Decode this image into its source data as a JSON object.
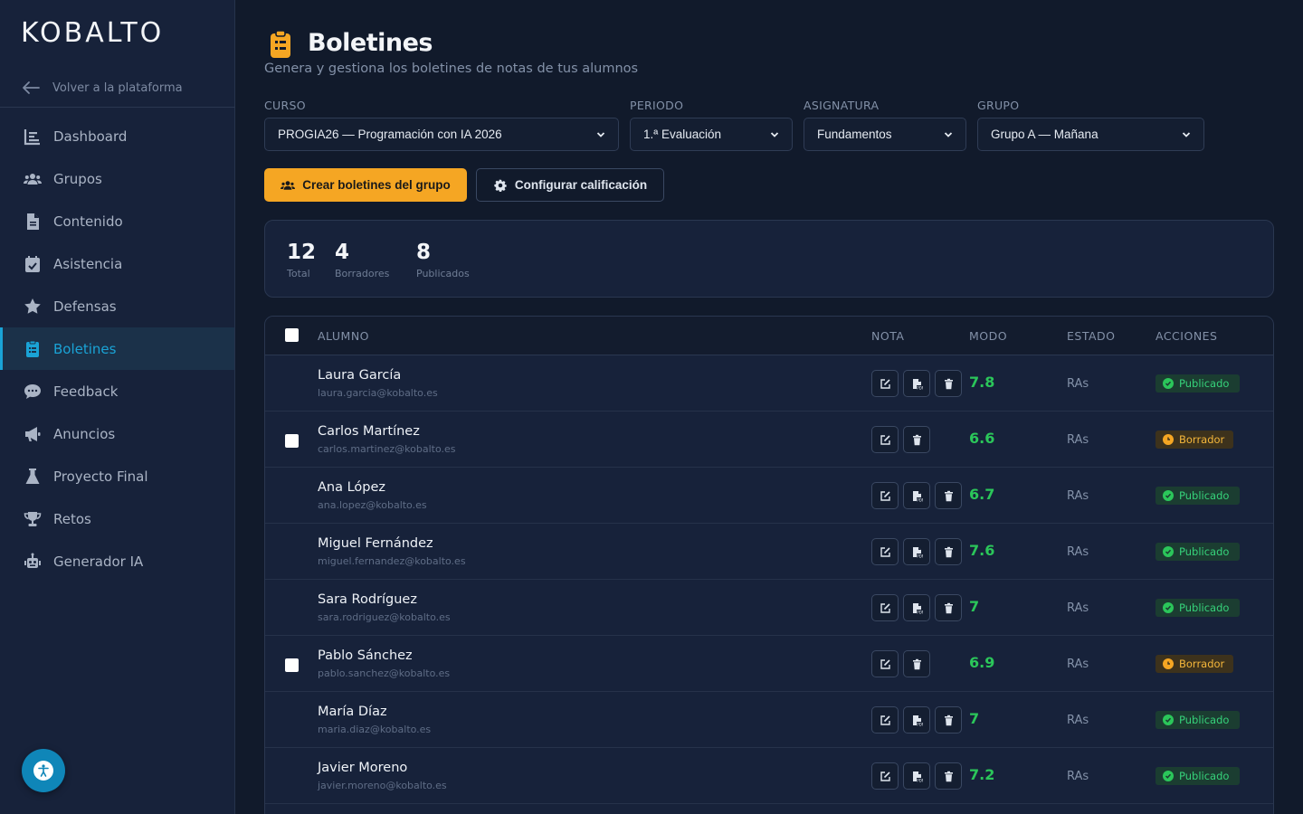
{
  "app": {
    "logo": "KOBALTO",
    "back_label": "Volver a la plataforma"
  },
  "sidebar": {
    "items": [
      {
        "label": "Dashboard",
        "icon": "chart-icon",
        "active": false
      },
      {
        "label": "Grupos",
        "icon": "users-icon",
        "active": false
      },
      {
        "label": "Contenido",
        "icon": "file-icon",
        "active": false
      },
      {
        "label": "Asistencia",
        "icon": "calendar-check-icon",
        "active": false
      },
      {
        "label": "Defensas",
        "icon": "star-icon",
        "active": false
      },
      {
        "label": "Boletines",
        "icon": "clipboard-icon",
        "active": true
      },
      {
        "label": "Feedback",
        "icon": "comments-icon",
        "active": false
      },
      {
        "label": "Anuncios",
        "icon": "megaphone-icon",
        "active": false
      },
      {
        "label": "Proyecto Final",
        "icon": "flask-icon",
        "active": false
      },
      {
        "label": "Retos",
        "icon": "trophy-icon",
        "active": false
      },
      {
        "label": "Generador IA",
        "icon": "robot-icon",
        "active": false
      }
    ]
  },
  "header": {
    "title": "Boletines",
    "subtitle": "Genera y gestiona los boletines de notas de tus alumnos"
  },
  "filters": {
    "curso": {
      "label": "CURSO",
      "value": "PROGIA26 — Programación con IA 2026"
    },
    "periodo": {
      "label": "PERIODO",
      "value": "1.ª Evaluación"
    },
    "asignatura": {
      "label": "ASIGNATURA",
      "value": "Fundamentos"
    },
    "grupo": {
      "label": "GRUPO",
      "value": "Grupo A — Mañana"
    }
  },
  "actions": {
    "create_label": "Crear boletines del grupo",
    "config_label": "Configurar calificación"
  },
  "stats": {
    "total": {
      "value": "12",
      "label": "Total"
    },
    "borradores": {
      "value": "4",
      "label": "Borradores"
    },
    "publicados": {
      "value": "8",
      "label": "Publicados"
    }
  },
  "table": {
    "headers": {
      "alumno": "ALUMNO",
      "nota": "NOTA",
      "modo": "MODO",
      "estado": "ESTADO",
      "acciones": "ACCIONES"
    },
    "rows": [
      {
        "name": "Laura García",
        "email": "laura.garcia@kobalto.es",
        "grade": "7.8",
        "mode": "RAs",
        "status": "Publicado"
      },
      {
        "name": "Carlos Martínez",
        "email": "carlos.martinez@kobalto.es",
        "grade": "6.6",
        "mode": "RAs",
        "status": "Borrador"
      },
      {
        "name": "Ana López",
        "email": "ana.lopez@kobalto.es",
        "grade": "6.7",
        "mode": "RAs",
        "status": "Publicado"
      },
      {
        "name": "Miguel Fernández",
        "email": "miguel.fernandez@kobalto.es",
        "grade": "7.6",
        "mode": "RAs",
        "status": "Publicado"
      },
      {
        "name": "Sara Rodríguez",
        "email": "sara.rodriguez@kobalto.es",
        "grade": "7",
        "mode": "RAs",
        "status": "Publicado"
      },
      {
        "name": "Pablo Sánchez",
        "email": "pablo.sanchez@kobalto.es",
        "grade": "6.9",
        "mode": "RAs",
        "status": "Borrador"
      },
      {
        "name": "María Díaz",
        "email": "maria.diaz@kobalto.es",
        "grade": "7",
        "mode": "RAs",
        "status": "Publicado"
      },
      {
        "name": "Javier Moreno",
        "email": "javier.moreno@kobalto.es",
        "grade": "7.2",
        "mode": "RAs",
        "status": "Publicado"
      }
    ]
  },
  "colors": {
    "accent": "#1aa3d6",
    "primary_button": "#f5a623",
    "published": "#2bc65a",
    "draft": "#f5a623"
  }
}
